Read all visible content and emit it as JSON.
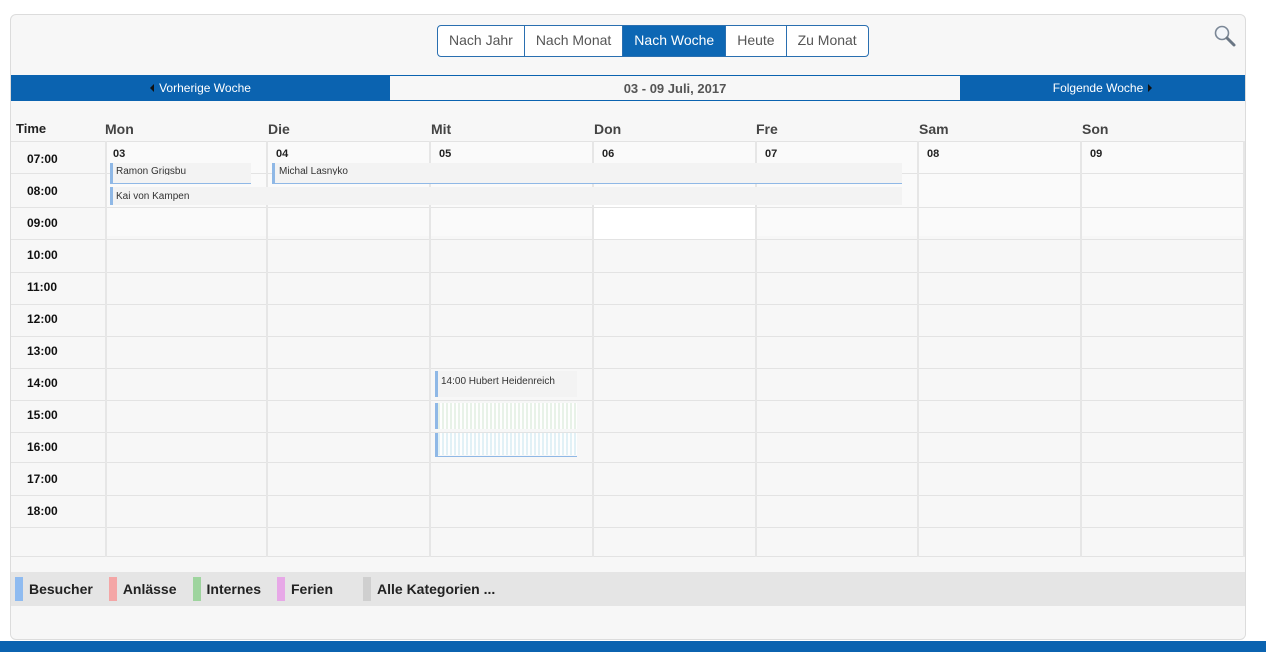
{
  "view_buttons": [
    "Nach Jahr",
    "Nach Monat",
    "Nach Woche",
    "Heute",
    "Zu Monat"
  ],
  "active_view": "Nach Woche",
  "nav": {
    "prev_label": "Vorherige Woche",
    "title": "03 - 09 Juli, 2017",
    "next_label": "Folgende Woche"
  },
  "grid": {
    "time_header": "Time",
    "days": [
      {
        "name": "Mon",
        "date": "03"
      },
      {
        "name": "Die",
        "date": "04"
      },
      {
        "name": "Mit",
        "date": "05"
      },
      {
        "name": "Don",
        "date": "06"
      },
      {
        "name": "Fre",
        "date": "07"
      },
      {
        "name": "Sam",
        "date": "08"
      },
      {
        "name": "Son",
        "date": "09"
      }
    ],
    "times": [
      "07:00",
      "08:00",
      "09:00",
      "10:00",
      "11:00",
      "12:00",
      "13:00",
      "14:00",
      "15:00",
      "16:00",
      "17:00",
      "18:00"
    ]
  },
  "events": {
    "mon_partial": "Ramon Grigsbu",
    "die_partial": "Michal Lasnyko",
    "kai": "Kai von Kampen",
    "mit_1400": "14:00 Hubert Heidenreich"
  },
  "legend": [
    {
      "label": "Besucher",
      "color": "#8fbbf0"
    },
    {
      "label": "Anlässe",
      "color": "#f4a6a6"
    },
    {
      "label": "Internes",
      "color": "#9ed49e"
    },
    {
      "label": "Ferien",
      "color": "#e7a8e7"
    },
    {
      "label": "Alle Kategorien ...",
      "color": "#cfcfcf"
    }
  ],
  "colors": {
    "accent": "#0b63b0"
  },
  "icons": {
    "search": "search-icon"
  }
}
